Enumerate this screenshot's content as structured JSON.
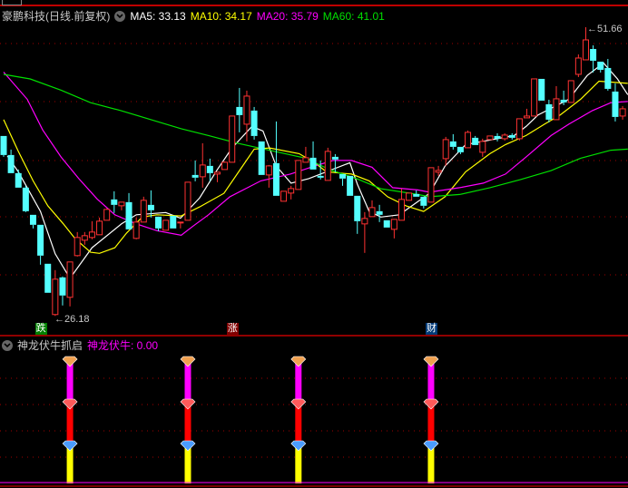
{
  "header": {
    "stock_title": "豪鹏科技(日线.前复权)",
    "ma5": "MA5: 33.13",
    "ma10": "MA10: 34.17",
    "ma20": "MA20: 35.79",
    "ma60": "MA60: 41.01"
  },
  "sub_header": {
    "indicator_name": "神龙伏牛抓启",
    "indicator_value": "神龙伏牛: 0.00"
  },
  "price_labels": {
    "high": "←51.66",
    "low": "←26.18"
  },
  "signals": [
    {
      "label": "跌",
      "index": 5,
      "color": "#008000"
    },
    {
      "label": "涨",
      "index": 31,
      "color": "#800000"
    },
    {
      "label": "财",
      "index": 58,
      "color": "#003a78"
    }
  ],
  "colors": {
    "up": "#ff3232",
    "down": "#54ffff",
    "ma5": "#ffffff",
    "ma10": "#ffff00",
    "ma20": "#ff00ff",
    "ma60": "#00e000",
    "grid": "#a00000"
  },
  "chart_data": {
    "type": "candlestick",
    "title": "豪鹏科技(日线.前复权)",
    "ylim": [
      24.6,
      52.3
    ],
    "grid": true,
    "candle_fields": [
      "open",
      "close",
      "high",
      "low"
    ],
    "candles": [
      [
        42.06,
        40.38,
        42.06,
        40.22
      ],
      [
        40.38,
        38.78,
        40.86,
        38.78
      ],
      [
        38.78,
        37.5,
        39.1,
        37.5
      ],
      [
        37.5,
        35.42,
        37.66,
        35.34
      ],
      [
        35.1,
        34.22,
        35.1,
        33.9
      ],
      [
        34.22,
        31.5,
        34.22,
        30.7
      ],
      [
        30.78,
        28.22,
        30.78,
        28.22
      ],
      [
        26.3,
        29.42,
        30.22,
        26.18
      ],
      [
        29.58,
        27.98,
        29.66,
        27.1
      ],
      [
        27.82,
        30.94,
        30.94,
        27.02
      ],
      [
        31.5,
        33.1,
        33.58,
        31.42
      ],
      [
        32.86,
        33.26,
        33.58,
        32.46
      ],
      [
        33.1,
        33.58,
        34.54,
        32.94
      ],
      [
        33.34,
        34.54,
        34.86,
        33.34
      ],
      [
        34.62,
        35.58,
        35.66,
        34.62
      ],
      [
        36.46,
        35.98,
        37.18,
        35.26
      ],
      [
        35.9,
        36.22,
        36.22,
        35.5
      ],
      [
        36.22,
        33.82,
        37.02,
        33.82
      ],
      [
        33.02,
        34.46,
        34.86,
        32.94
      ],
      [
        34.46,
        36.38,
        36.7,
        34.46
      ],
      [
        35.98,
        35.5,
        37.26,
        34.86
      ],
      [
        34.94,
        33.9,
        34.94,
        33.66
      ],
      [
        33.74,
        34.62,
        34.62,
        33.74
      ],
      [
        35.02,
        33.9,
        35.02,
        33.9
      ],
      [
        34.38,
        34.46,
        34.46,
        33.9
      ],
      [
        34.62,
        37.98,
        37.98,
        34.62
      ],
      [
        38.62,
        38.38,
        39.9,
        38.06
      ],
      [
        38.46,
        39.5,
        41.42,
        37.5
      ],
      [
        39.42,
        38.78,
        40.06,
        38.06
      ],
      [
        38.7,
        38.86,
        38.86,
        37.98
      ],
      [
        39.1,
        39.74,
        39.82,
        39.1
      ],
      [
        39.74,
        43.82,
        43.82,
        39.74
      ],
      [
        44.62,
        43.9,
        46.3,
        42.38
      ],
      [
        43.1,
        45.58,
        46.06,
        41.58
      ],
      [
        44.3,
        42.06,
        44.62,
        41.74
      ],
      [
        41.58,
        38.62,
        41.58,
        38.62
      ],
      [
        38.62,
        39.42,
        39.5,
        37.5
      ],
      [
        39.66,
        36.78,
        43.34,
        36.78
      ],
      [
        36.3,
        37.18,
        37.18,
        36.3
      ],
      [
        37.02,
        37.42,
        37.66,
        36.46
      ],
      [
        37.34,
        39.9,
        39.9,
        37.34
      ],
      [
        39.74,
        40.14,
        41.1,
        39.74
      ],
      [
        40.14,
        39.1,
        41.58,
        39.1
      ],
      [
        38.54,
        38.38,
        39.9,
        38.22
      ],
      [
        38.14,
        40.7,
        41.02,
        38.14
      ],
      [
        40.22,
        39.98,
        40.46,
        38.86
      ],
      [
        38.7,
        38.3,
        38.7,
        37.66
      ],
      [
        38.54,
        36.78,
        38.54,
        36.78
      ],
      [
        36.78,
        34.54,
        36.78,
        33.42
      ],
      [
        34.3,
        34.78,
        35.34,
        31.74
      ],
      [
        34.94,
        35.74,
        36.38,
        34.94
      ],
      [
        35.42,
        35.1,
        35.98,
        34.46
      ],
      [
        34.62,
        33.98,
        34.62,
        33.98
      ],
      [
        33.82,
        34.7,
        34.7,
        33.02
      ],
      [
        34.62,
        36.46,
        37.42,
        34.62
      ],
      [
        36.38,
        37.02,
        37.02,
        36.38
      ],
      [
        36.94,
        36.7,
        37.26,
        36.7
      ],
      [
        36.7,
        35.9,
        36.7,
        35.66
      ],
      [
        36.22,
        39.26,
        39.26,
        36.22
      ],
      [
        38.86,
        39.02,
        39.42,
        38.54
      ],
      [
        40.06,
        41.74,
        41.98,
        39.42
      ],
      [
        41.58,
        41.1,
        42.22,
        40.86
      ],
      [
        41.1,
        40.62,
        41.1,
        40.46
      ],
      [
        41.02,
        42.38,
        42.54,
        41.02
      ],
      [
        41.9,
        41.26,
        42.06,
        41.26
      ],
      [
        40.62,
        41.58,
        41.82,
        40.22
      ],
      [
        41.74,
        42.06,
        42.06,
        41.74
      ],
      [
        42.06,
        41.82,
        42.3,
        41.58
      ],
      [
        41.82,
        42.14,
        42.3,
        41.66
      ],
      [
        42.14,
        41.9,
        42.3,
        41.74
      ],
      [
        41.82,
        43.58,
        43.58,
        41.66
      ],
      [
        43.66,
        43.82,
        44.46,
        43.66
      ],
      [
        43.82,
        47.1,
        47.1,
        43.82
      ],
      [
        47.1,
        45.18,
        47.1,
        45.18
      ],
      [
        44.86,
        43.5,
        45.26,
        43.26
      ],
      [
        43.5,
        45.34,
        46.46,
        43.5
      ],
      [
        45.26,
        45.02,
        46.06,
        44.78
      ],
      [
        45.02,
        46.94,
        46.94,
        45.02
      ],
      [
        47.5,
        48.94,
        49.26,
        47.26
      ],
      [
        48.78,
        50.54,
        51.66,
        48.78
      ],
      [
        49.74,
        48.7,
        50.06,
        47.66
      ],
      [
        48.62,
        47.9,
        48.62,
        47.66
      ],
      [
        48.06,
        46.22,
        48.86,
        46.06
      ],
      [
        45.98,
        43.74,
        46.7,
        43.34
      ],
      [
        43.82,
        44.46,
        44.7,
        43.5
      ]
    ],
    "series": [
      {
        "name": "MA5",
        "points": [
          [
            0.5,
            40.3
          ],
          [
            2,
            38.9
          ],
          [
            5,
            35.4
          ],
          [
            7,
            31.66
          ],
          [
            9,
            29.5
          ],
          [
            12,
            32.2
          ],
          [
            16,
            34.3
          ],
          [
            18,
            35.1
          ],
          [
            22,
            35.3
          ],
          [
            24,
            34.8
          ],
          [
            26.6,
            36.6
          ],
          [
            29,
            39.1
          ],
          [
            31,
            41.0
          ],
          [
            33.7,
            42.9
          ],
          [
            35.2,
            42.5
          ],
          [
            37,
            39.4
          ],
          [
            39,
            37.9
          ],
          [
            41.4,
            38.3
          ],
          [
            47,
            39.7
          ],
          [
            48,
            37.8
          ],
          [
            49.6,
            35.4
          ],
          [
            51.2,
            34.9
          ],
          [
            53.7,
            35.1
          ],
          [
            57.8,
            37.0
          ],
          [
            59.9,
            39.4
          ],
          [
            62.7,
            41.3
          ],
          [
            66,
            41.7
          ],
          [
            69.3,
            42.1
          ],
          [
            70.9,
            42.9
          ],
          [
            72.5,
            43.9
          ],
          [
            76.7,
            45.3
          ],
          [
            79.2,
            47.4
          ],
          [
            81.4,
            48.5
          ],
          [
            83.3,
            47.1
          ],
          [
            84.7,
            45.7
          ]
        ]
      },
      {
        "name": "MA10",
        "points": [
          [
            0,
            43.5
          ],
          [
            2,
            40.7
          ],
          [
            4,
            38.1
          ],
          [
            6,
            35.9
          ],
          [
            8.1,
            34.3
          ],
          [
            9.7,
            33.0
          ],
          [
            11.8,
            31.8
          ],
          [
            13,
            31.7
          ],
          [
            15.1,
            32.2
          ],
          [
            16.7,
            33.5
          ],
          [
            18.8,
            34.9
          ],
          [
            20.8,
            35.1
          ],
          [
            24.1,
            35.0
          ],
          [
            26.6,
            35.8
          ],
          [
            29.9,
            37.0
          ],
          [
            31.9,
            38.9
          ],
          [
            34,
            40.9
          ],
          [
            36.1,
            41.0
          ],
          [
            40.1,
            40.5
          ],
          [
            42.2,
            39.7
          ],
          [
            43.8,
            38.9
          ],
          [
            47.2,
            38.7
          ],
          [
            49.6,
            38.1
          ],
          [
            52.1,
            36.7
          ],
          [
            54.6,
            35.9
          ],
          [
            57,
            35.4
          ],
          [
            59.9,
            36.7
          ],
          [
            62.7,
            38.9
          ],
          [
            66,
            40.5
          ],
          [
            68.1,
            41.3
          ],
          [
            70.9,
            42.1
          ],
          [
            73.4,
            43.1
          ],
          [
            75.5,
            43.9
          ],
          [
            78.3,
            45.3
          ],
          [
            80.8,
            46.9
          ],
          [
            84.7,
            46.7
          ]
        ]
      },
      {
        "name": "MA20",
        "points": [
          [
            0,
            47.7
          ],
          [
            3.2,
            45.3
          ],
          [
            5.3,
            42.6
          ],
          [
            7.8,
            40.2
          ],
          [
            10.2,
            38.3
          ],
          [
            12.7,
            36.5
          ],
          [
            15.1,
            35.1
          ],
          [
            18,
            34.3
          ],
          [
            20.8,
            33.7
          ],
          [
            24.1,
            33.3
          ],
          [
            25.7,
            34.1
          ],
          [
            27.8,
            35.1
          ],
          [
            30.7,
            36.7
          ],
          [
            34.9,
            38.1
          ],
          [
            38.9,
            38.7
          ],
          [
            42.2,
            39.4
          ],
          [
            44.7,
            39.9
          ],
          [
            47.2,
            39.9
          ],
          [
            50,
            39.3
          ],
          [
            52.8,
            37.5
          ],
          [
            56.2,
            37.3
          ],
          [
            57.8,
            37.1
          ],
          [
            61.9,
            37.5
          ],
          [
            65.1,
            37.9
          ],
          [
            68.1,
            38.7
          ],
          [
            70.9,
            40.2
          ],
          [
            74.3,
            42.1
          ],
          [
            76.7,
            43.1
          ],
          [
            79.9,
            44.3
          ],
          [
            82.4,
            45.0
          ],
          [
            84.7,
            45.1
          ]
        ]
      },
      {
        "name": "MA60",
        "points": [
          [
            0,
            47.5
          ],
          [
            3.6,
            47.1
          ],
          [
            7.8,
            46.1
          ],
          [
            11.8,
            45.0
          ],
          [
            15.9,
            44.3
          ],
          [
            20,
            43.5
          ],
          [
            24.1,
            42.7
          ],
          [
            27.8,
            42.1
          ],
          [
            31.9,
            41.4
          ],
          [
            36.8,
            40.7
          ],
          [
            41,
            40.1
          ],
          [
            44.2,
            39.1
          ],
          [
            47.9,
            38.3
          ],
          [
            51.2,
            37.4
          ],
          [
            56.2,
            36.9
          ],
          [
            57.8,
            36.7
          ],
          [
            61.9,
            36.9
          ],
          [
            66,
            37.5
          ],
          [
            70.1,
            38.2
          ],
          [
            74.3,
            39.0
          ],
          [
            78.3,
            40.1
          ],
          [
            82.4,
            40.8
          ],
          [
            84.7,
            40.9
          ]
        ]
      }
    ],
    "annotations": [
      {
        "text": "51.66",
        "index": 79,
        "value": 51.66
      },
      {
        "text": "26.18",
        "index": 7,
        "value": 26.18
      }
    ],
    "indicator": {
      "name": "神龙伏牛",
      "value": 0.0,
      "signal_indices": [
        9,
        25,
        40,
        58
      ],
      "segment_colors": [
        "#ffff00",
        "#ff0000",
        "#ff00ff"
      ],
      "gem_colors": [
        "#4a9cff",
        "#ff5a5a",
        "#f0a050"
      ]
    }
  }
}
